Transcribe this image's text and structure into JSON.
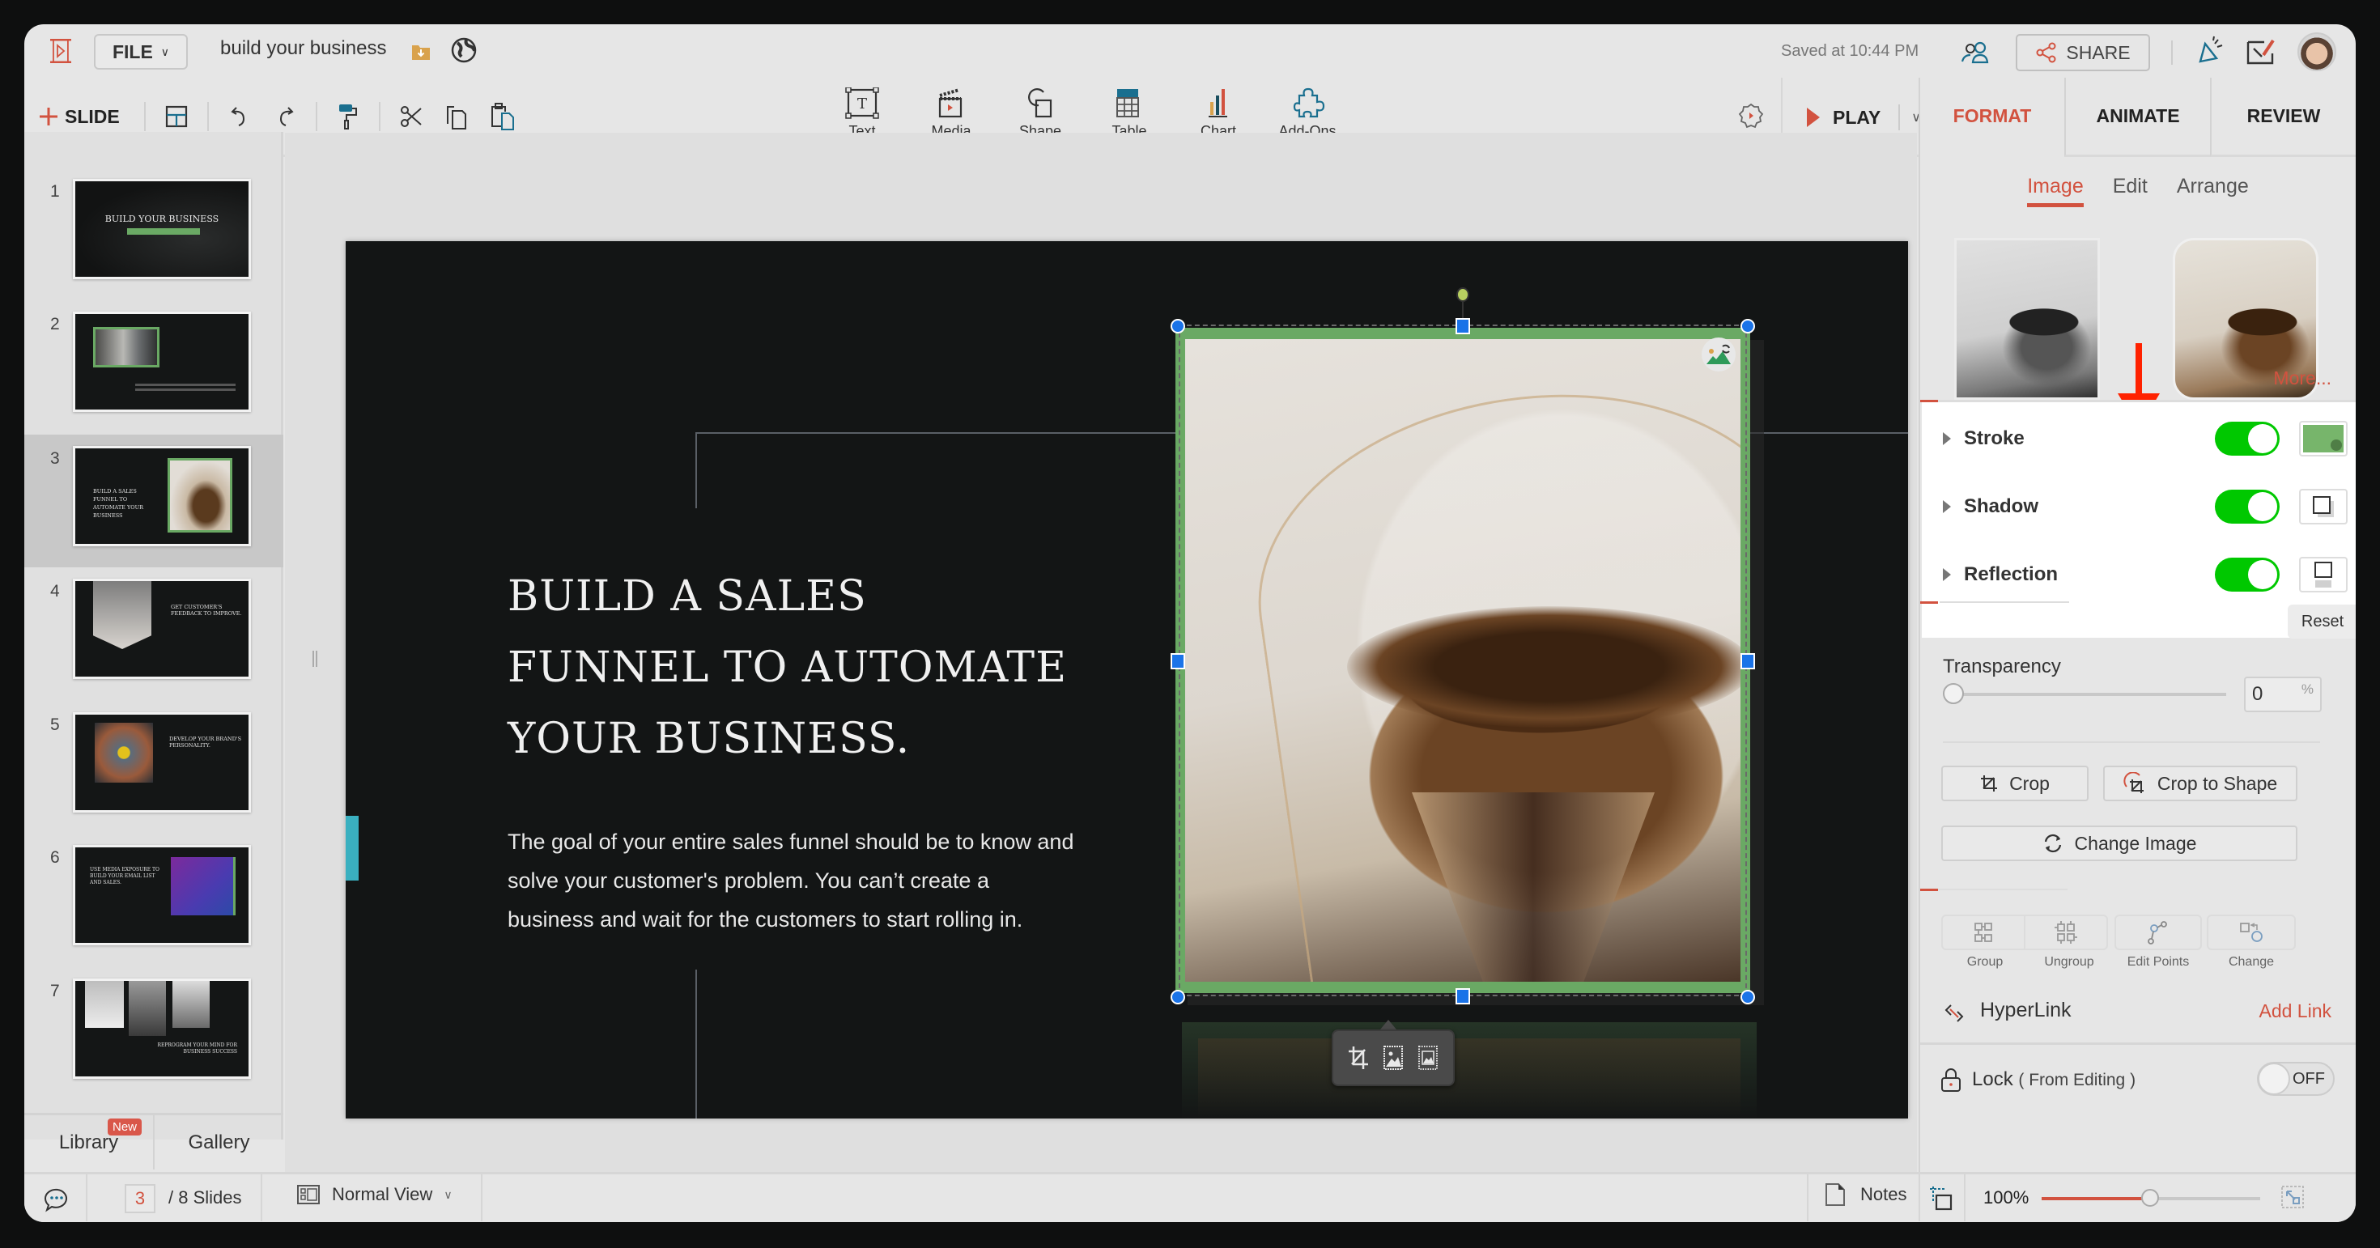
{
  "header": {
    "file_label": "FILE",
    "document_title": "build your business",
    "saved_status": "Saved at 10:44 PM",
    "share_label": "SHARE"
  },
  "toolbar": {
    "add_slide_label": "SLIDE",
    "insert_items": [
      {
        "label": "Text",
        "icon": "text-box-icon"
      },
      {
        "label": "Media",
        "icon": "media-clapper-icon"
      },
      {
        "label": "Shape",
        "icon": "shape-icon"
      },
      {
        "label": "Table",
        "icon": "table-icon"
      },
      {
        "label": "Chart",
        "icon": "chart-icon"
      },
      {
        "label": "Add-Ons",
        "icon": "puzzle-icon"
      }
    ],
    "play_label": "PLAY"
  },
  "right_tabs": [
    {
      "label": "FORMAT",
      "active": true
    },
    {
      "label": "ANIMATE",
      "active": false
    },
    {
      "label": "REVIEW",
      "active": false
    }
  ],
  "format_panel": {
    "subtabs": [
      {
        "label": "Image",
        "active": true
      },
      {
        "label": "Edit",
        "active": false
      },
      {
        "label": "Arrange",
        "active": false
      }
    ],
    "more_link": "More...",
    "effects": [
      {
        "label": "Stroke",
        "enabled": true,
        "swatch_color": "#77b56b"
      },
      {
        "label": "Shadow",
        "enabled": true
      },
      {
        "label": "Reflection",
        "enabled": true
      }
    ],
    "reset_label": "Reset",
    "transparency_label": "Transparency",
    "transparency_value": "0",
    "transparency_unit": "%",
    "crop_label": "Crop",
    "crop_to_shape_label": "Crop to Shape",
    "change_image_label": "Change Image",
    "shape_actions": [
      {
        "label": "Group"
      },
      {
        "label": "Ungroup"
      },
      {
        "label": "Edit Points"
      },
      {
        "label": "Change"
      }
    ],
    "hyperlink_label": "HyperLink",
    "add_link_label": "Add Link",
    "lock_label": "Lock",
    "lock_sub": "( From Editing )",
    "lock_state": "OFF"
  },
  "slides_panel": {
    "slides": [
      {
        "number": "1",
        "title": "BUILD YOUR BUSINESS"
      },
      {
        "number": "2",
        "title": ""
      },
      {
        "number": "3",
        "title": "BUILD A SALES FUNNEL TO AUTOMATE YOUR BUSINESS",
        "selected": true
      },
      {
        "number": "4",
        "title": "GET CUSTOMER'S FEEDBACK TO IMPROVE."
      },
      {
        "number": "5",
        "title": "DEVELOP YOUR BRAND'S PERSONALITY."
      },
      {
        "number": "6",
        "title": "USE MEDIA EXPOSURE TO BUILD YOUR EMAIL LIST AND SALES."
      },
      {
        "number": "7",
        "title": "REPROGRAM YOUR MIND FOR BUSINESS SUCCESS"
      }
    ],
    "library_label": "Library",
    "library_badge": "New",
    "gallery_label": "Gallery"
  },
  "slide": {
    "heading_lines": [
      "BUILD A SALES",
      "FUNNEL TO AUTOMATE",
      "YOUR BUSINESS."
    ],
    "body_lines": [
      "The goal of your entire sales funnel should be to know and",
      "solve your customer's problem. You can’t create a",
      "business  and wait for the customers  to start rolling in."
    ]
  },
  "status_bar": {
    "current_slide": "3",
    "total_slides": "/ 8 Slides",
    "view_mode": "Normal View",
    "notes_label": "Notes",
    "zoom_level": "100%",
    "zoom_fraction": 0.5
  },
  "colors": {
    "accent": "#d2523f",
    "toggle_on": "#00c800",
    "stroke_green": "#6aa964",
    "selection_blue": "#1a73e8",
    "slide_bg": "#131515"
  }
}
